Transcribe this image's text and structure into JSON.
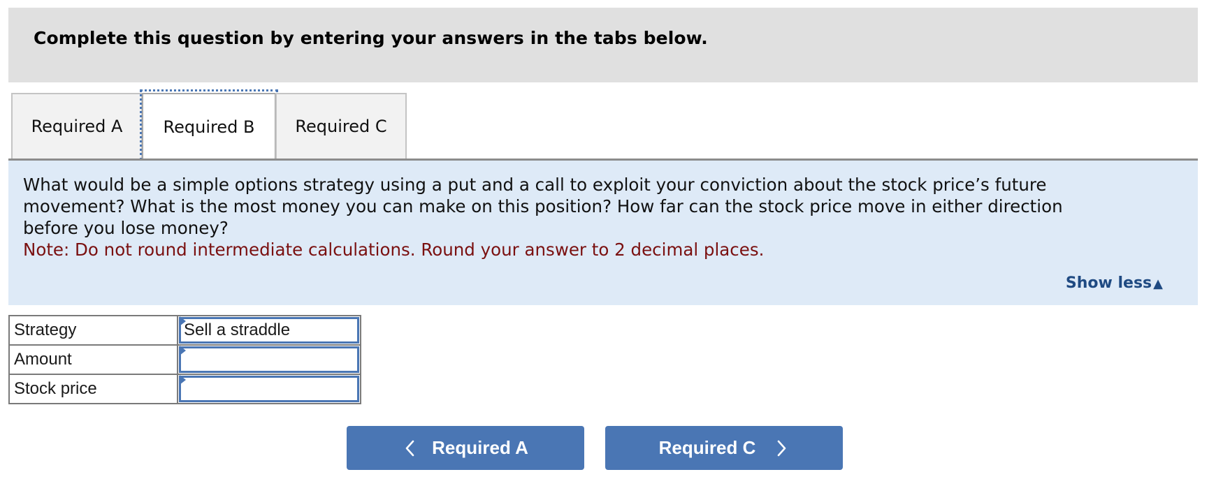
{
  "header": {
    "title": "Complete this question by entering your answers in the tabs below."
  },
  "tabs": [
    {
      "label": "Required A",
      "active": false
    },
    {
      "label": "Required B",
      "active": true
    },
    {
      "label": "Required C",
      "active": false
    }
  ],
  "question": {
    "lines": [
      "What would be a simple options strategy using a put and a call to exploit your conviction about the stock price’s future",
      "movement? What is the most money you can make on this position? How far can the stock price move in either direction",
      "before you lose money?"
    ],
    "note": "Note: Do not round intermediate calculations. Round your answer to 2 decimal places.",
    "toggle_label": "Show less",
    "toggle_icon": "triangle-up-icon"
  },
  "answer_table": {
    "rows": [
      {
        "label": "Strategy",
        "value": ""
      },
      {
        "label": "Amount",
        "value": ""
      },
      {
        "label": "Stock price",
        "value": ""
      }
    ],
    "strategy_value": "Sell a straddle"
  },
  "navigation": {
    "prev_label": "Required A",
    "next_label": "Required C",
    "prev_icon": "chevron-left-icon",
    "next_icon": "chevron-right-icon"
  },
  "colors": {
    "accent": "#4a76b4",
    "header_bg": "#e0e0e0",
    "question_bg": "#deeaf7",
    "note_text": "#7a1010",
    "link_text": "#1f4a82"
  }
}
